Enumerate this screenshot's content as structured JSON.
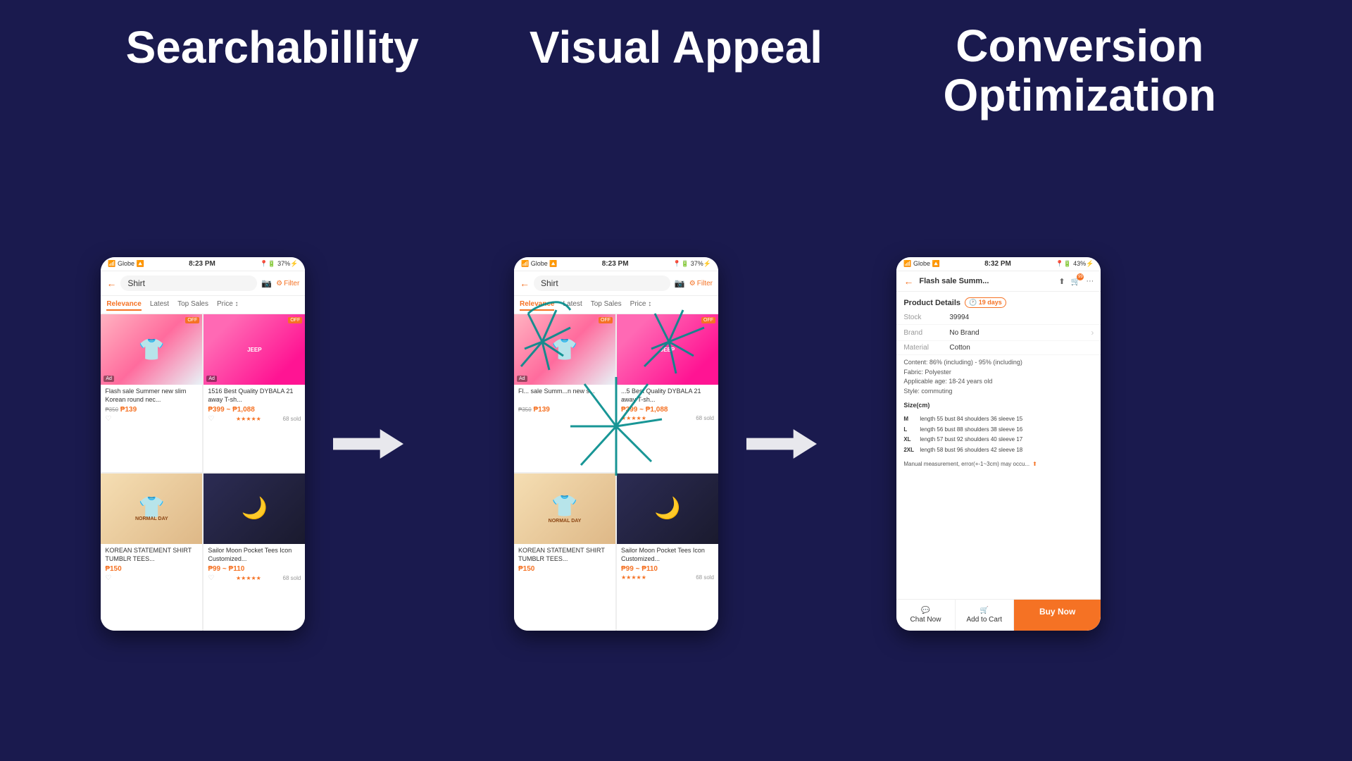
{
  "background_color": "#1a1a4e",
  "sections": [
    {
      "id": "searchability",
      "title": "Searchabillity"
    },
    {
      "id": "visual_appeal",
      "title": "Visual Appeal"
    },
    {
      "id": "conversion",
      "title": "Conversion Optimization"
    }
  ],
  "phone1": {
    "status_bar": {
      "carrier": "Globe",
      "time": "8:23 PM",
      "battery": "37%"
    },
    "search_text": "Shirt",
    "tabs": [
      "Relevance",
      "Latest",
      "Top Sales",
      "Price"
    ],
    "active_tab": "Relevance",
    "products": [
      {
        "name": "Flash sale Summer new slim Korean round nec...",
        "price": "₱139",
        "original_price": "₱350",
        "has_off": true,
        "is_ad": true,
        "color": "pink_shirt"
      },
      {
        "name": "1516 Best Quality DYBALA 21 away T-sh...",
        "price": "₱399 ~ ₱1,088",
        "has_off": true,
        "is_ad": false,
        "color": "jeep_shirt"
      },
      {
        "name": "KOREAN STATEMENT SHIRT TUMBLR TEES...",
        "price": "₱150",
        "has_off": false,
        "is_ad": false,
        "color": "beige_shirt"
      },
      {
        "name": "Sailor Moon Pocket Tees Icon Customized...",
        "price": "₱99 ~ ₱110",
        "has_off": false,
        "is_ad": false,
        "color": "dark_shirt",
        "stars": "★★★★★",
        "sold": "68 sold"
      }
    ]
  },
  "phone2": {
    "status_bar": {
      "carrier": "Globe",
      "time": "8:23 PM",
      "battery": "37%"
    },
    "search_text": "Shirt",
    "has_annotations": true
  },
  "phone3": {
    "status_bar": {
      "carrier": "Globe",
      "time": "8:32 PM",
      "battery": "43%"
    },
    "title": "Flash sale Summ...",
    "section_title": "Product Details",
    "days": "19 days",
    "details": [
      {
        "label": "Stock",
        "value": "39994",
        "has_arrow": false
      },
      {
        "label": "Brand",
        "value": "No Brand",
        "has_arrow": true
      },
      {
        "label": "Material",
        "value": "Cotton",
        "has_arrow": false
      }
    ],
    "text_details": [
      "Content: 86% (including) - 95% (including)",
      "Fabric: Polyester",
      "Applicable age: 18-24 years old",
      "Style: commuting"
    ],
    "size_label": "Size(cm)",
    "sizes": [
      {
        "size": "M",
        "length": 55,
        "bust": 84,
        "shoulders": 36,
        "sleeve": 15
      },
      {
        "size": "L",
        "length": 56,
        "bust": 88,
        "shoulders": 38,
        "sleeve": 16
      },
      {
        "size": "XL",
        "length": 57,
        "bust": 92,
        "shoulders": 40,
        "sleeve": 17
      },
      {
        "size": "2XL",
        "length": 58,
        "bust": 96,
        "shoulders": 42,
        "sleeve": 18
      }
    ],
    "measurement_note": "Manual measurement, error(+-1~3cm) may occu...",
    "actions": [
      {
        "label": "Chat Now",
        "icon": "💬"
      },
      {
        "label": "Add to Cart",
        "icon": "🛒"
      },
      {
        "label": "Buy Now",
        "is_primary": true
      }
    ]
  },
  "arrows": {
    "color": "white"
  }
}
